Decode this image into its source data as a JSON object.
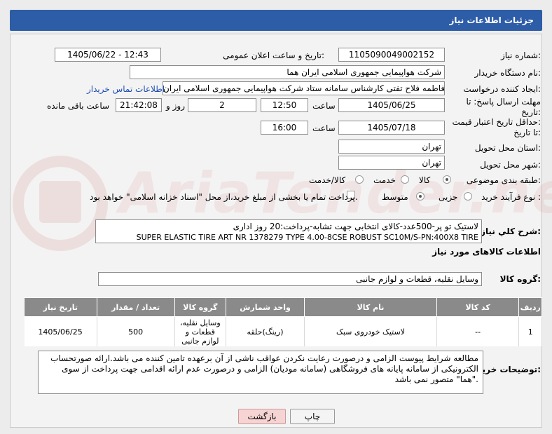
{
  "title": "جزئیات اطلاعات نیاز",
  "fields": {
    "need_number_label": "شماره نیاز:",
    "need_number": "1105090049002152",
    "announce_label": "تاریخ و ساعت اعلان عمومی:",
    "announce_value": "1405/06/22 - 12:43",
    "buyer_org_label": "نام دستگاه خریدار:",
    "buyer_org": "شرکت هواپیمایی جمهوری اسلامی ایران هما",
    "requester_label": "ایجاد کننده درخواست:",
    "requester": "فاطمه فلاح تفتی کارشناس سامانه ستاد شرکت هواپیمایی جمهوری اسلامی ایران",
    "contact_link": "اطلاعات تماس خریدار",
    "deadline_label_1": "مهلت ارسال پاسخ: تا",
    "deadline_label_2": "تاریخ:",
    "deadline_date": "1405/06/25",
    "time_label": "ساعت",
    "deadline_time": "12:50",
    "days": "2",
    "days_label": "روز و",
    "remaining": "21:42:08",
    "remaining_label": "ساعت باقی مانده",
    "validity_label_1": "حداقل تاریخ اعتبار قیمت:",
    "validity_label_2": "تا تاریخ:",
    "validity_date": "1405/07/18",
    "validity_time": "16:00",
    "province_label": "استان محل تحویل:",
    "province": "تهران",
    "city_label": "شهر محل تحویل:",
    "city": "تهران",
    "category_label": "طبقه بندی موضوعی:",
    "category_options": [
      "کالا",
      "خدمت",
      "کالا/خدمت"
    ],
    "category_selected": "کالا",
    "process_label": "نوع فرآیند خرید :",
    "process_options": [
      "جزیی",
      "متوسط"
    ],
    "process_selected": "متوسط",
    "payment_note": "پرداخت تمام یا بخشی از مبلغ خرید،از محل \"اسناد خزانه اسلامی\" خواهد بود.",
    "summary_label": "شرح کلي نياز:",
    "summary_line1": "لاستیک تو پر-500عدد-کالای انتخابی جهت تشابه-پرداخت:20 روز اداری",
    "summary_line2": "SUPER ELASTIC TIRE ART NR 1378279 TYPE 4.00-8CSE ROBUST SC10M/S-PN:400X8 TIRE",
    "goods_info_label": "اطلاعات کالاهای مورد نیاز",
    "goods_group_label": "گروه کالا:",
    "goods_group": "وسایل نقلیه، قطعات و لوازم جانبی",
    "buyer_notes_label": "توضیحات خریدار:",
    "buyer_notes": "مطالعه شرایط پیوست الزامی و درصورت رعایت نکردن عواقب ناشی از آن برعهده تامین کننده می باشد.ارائه صورتحساب الکترونیکی از سامانه پایانه های فروشگاهی (سامانه مودیان) الزامی و درصورت عدم ارائه اقدامی جهت پرداخت از سوی \"هما\" متصور نمی باشد."
  },
  "table": {
    "headers": [
      "ردیف",
      "کد کالا",
      "نام کالا",
      "واحد شمارش",
      "گروه کالا",
      "تعداد / مقدار",
      "تاریخ نیاز"
    ],
    "rows": [
      [
        "1",
        "--",
        "لاستیک خودروی سبک",
        "(رینگ)حلقه",
        "وسایل نقلیه، قطعات و لوازم جانبی",
        "500",
        "1405/06/25"
      ]
    ]
  },
  "buttons": {
    "print": "چاپ",
    "back": "بازگشت"
  },
  "watermark": "AriaTender.net",
  "colors": {
    "title_bg": "#2e5da8",
    "table_header_bg": "#8a8a8a",
    "link": "#1f4db3",
    "back_button_bg": "#f7d4d4"
  }
}
